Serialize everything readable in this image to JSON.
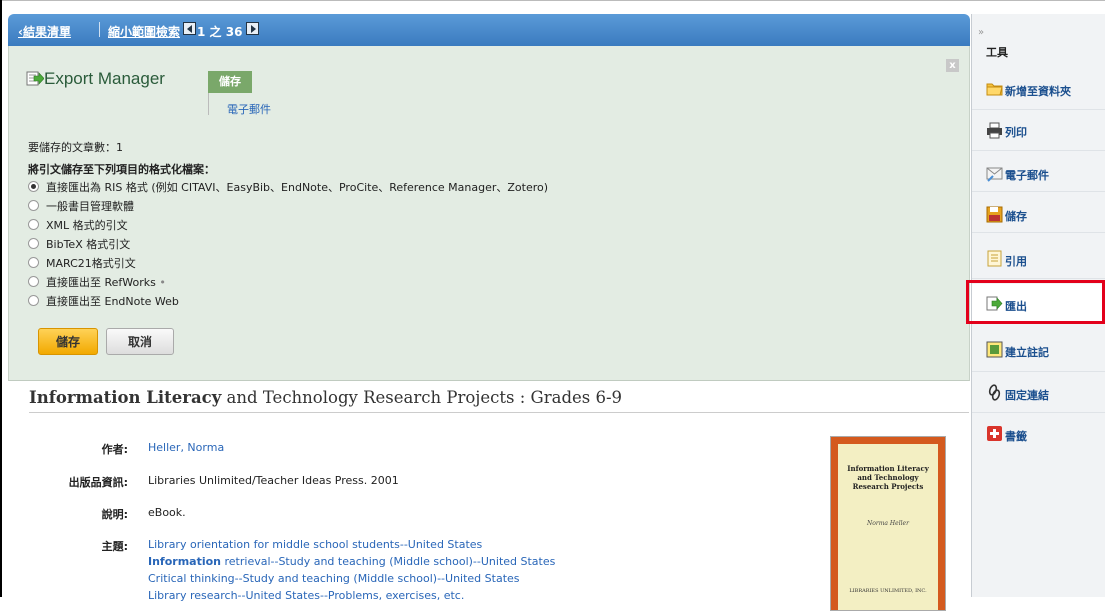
{
  "nav": {
    "back_label": "結果清單",
    "refine_label": "縮小範圍檢索",
    "page_current": "1",
    "page_of": "之",
    "page_total": "36"
  },
  "export_manager": {
    "title": "Export Manager",
    "tab_save": "儲存",
    "tab_email": "電子郵件",
    "close": "x",
    "count_label": "要儲存的文章數：1",
    "format_heading": "將引文儲存至下列項目的格式化檔案：",
    "options": [
      {
        "label": "直接匯出為 RIS 格式 (例如 CITAVI、EasyBib、EndNote、ProCite、Reference Manager、Zotero)",
        "selected": true
      },
      {
        "label": "一般書目管理軟體",
        "selected": false
      },
      {
        "label": "XML 格式的引文",
        "selected": false
      },
      {
        "label": "BibTeX 格式引文",
        "selected": false
      },
      {
        "label": "MARC21格式引文",
        "selected": false
      },
      {
        "label": "直接匯出至 RefWorks",
        "selected": false
      },
      {
        "label": "直接匯出至 EndNote Web",
        "selected": false
      }
    ],
    "save_button": "儲存",
    "cancel_button": "取消"
  },
  "record": {
    "title_bold": "Information Literacy",
    "title_rest": " and Technology Research Projects : Grades 6-9",
    "author_label": "作者:",
    "author_value": "Heller, Norma",
    "pub_label": "出版品資訊:",
    "pub_value": "Libraries Unlimited/Teacher Ideas Press. 2001",
    "desc_label": "說明:",
    "desc_value": "eBook.",
    "subject_label": "主題:",
    "subjects": [
      "Library orientation for middle school students--United States",
      "retrieval--Study and teaching (Middle school)--United States",
      "Critical thinking--Study and teaching (Middle school)--United States",
      "Library research--United States--Problems, exercises, etc."
    ],
    "subject2_bold": "Information",
    "cover": {
      "title_line1": "Information Literacy",
      "title_line2": "and Technology",
      "title_line3": "Research Projects",
      "author": "Norma Heller",
      "publisher": "LIBRARIES UNLIMITED, INC."
    }
  },
  "sidebar": {
    "collapse": "»",
    "title": "工具",
    "items": [
      {
        "label": "新增至資料夾",
        "icon": "folder-icon"
      },
      {
        "label": "列印",
        "icon": "printer-icon"
      },
      {
        "label": "電子郵件",
        "icon": "email-icon"
      },
      {
        "label": "儲存",
        "icon": "save-icon"
      },
      {
        "label": "引用",
        "icon": "cite-icon"
      },
      {
        "label": "匯出",
        "icon": "export-icon"
      },
      {
        "label": "建立註記",
        "icon": "note-icon"
      },
      {
        "label": "固定連結",
        "icon": "link-icon"
      },
      {
        "label": "書籤",
        "icon": "bookmark-icon"
      }
    ],
    "highlight_color": "#e3001b"
  }
}
